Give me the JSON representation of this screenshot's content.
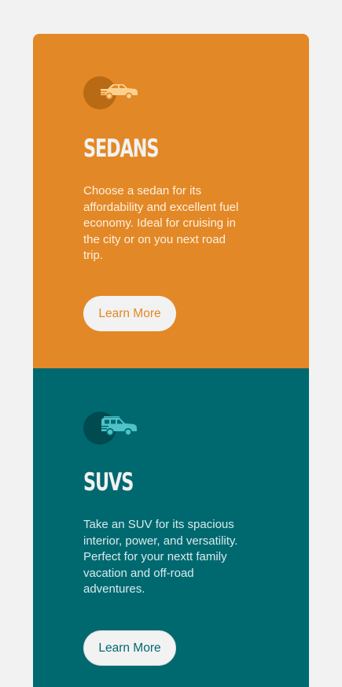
{
  "colors": {
    "background": "#f2f2f2",
    "sedans_card": "#e38826",
    "suvs_card": "#006970",
    "button_bg": "#f2f2f2"
  },
  "cards": [
    {
      "id": "sedans",
      "icon": "sedan-car-icon",
      "title": "Sedans",
      "text": "Choose a sedan for its affordability and excellent fuel economy. Ideal for cruising in the city or on you next road trip.",
      "button_label": "Learn More"
    },
    {
      "id": "suvs",
      "icon": "suv-car-icon",
      "title": "SUVs",
      "text": "Take an SUV for its spacious interior, power, and versatility. Perfect for your nextt family vacation and off-road adventures.",
      "button_label": "Learn More"
    }
  ]
}
